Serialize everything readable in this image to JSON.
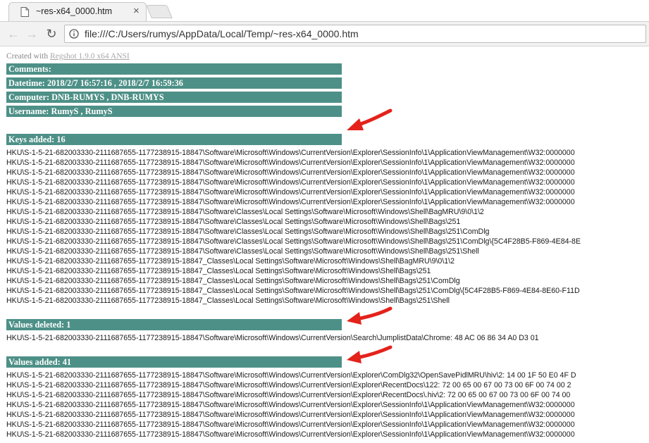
{
  "browser": {
    "tab_title": "~res-x64_0000.htm",
    "tab_close": "×",
    "url": "file:///C:/Users/rumys/AppData/Local/Temp/~res-x64_0000.htm",
    "icons": {
      "back": "←",
      "forward": "→",
      "reload": "↻"
    }
  },
  "page": {
    "created_prefix": "Created with ",
    "created_link": "Regshot 1.9.0 x64 ANSI",
    "headers": {
      "comments": "Comments:",
      "datetime": "Datetime: 2018/2/7 16:57:16 , 2018/2/7 16:59:36",
      "computer": "Computer: DNB-RUMYS , DNB-RUMYS",
      "username": "Username: RumyS , RumyS",
      "keys_added": "Keys added: 16",
      "values_deleted": "Values deleted: 1",
      "values_added": "Values added: 41"
    },
    "keys_added": [
      "HKU\\S-1-5-21-682003330-2111687655-1177238915-18847\\Software\\Microsoft\\Windows\\CurrentVersion\\Explorer\\SessionInfo\\1\\ApplicationViewManagement\\W32:0000000",
      "HKU\\S-1-5-21-682003330-2111687655-1177238915-18847\\Software\\Microsoft\\Windows\\CurrentVersion\\Explorer\\SessionInfo\\1\\ApplicationViewManagement\\W32:0000000",
      "HKU\\S-1-5-21-682003330-2111687655-1177238915-18847\\Software\\Microsoft\\Windows\\CurrentVersion\\Explorer\\SessionInfo\\1\\ApplicationViewManagement\\W32:0000000",
      "HKU\\S-1-5-21-682003330-2111687655-1177238915-18847\\Software\\Microsoft\\Windows\\CurrentVersion\\Explorer\\SessionInfo\\1\\ApplicationViewManagement\\W32:0000000",
      "HKU\\S-1-5-21-682003330-2111687655-1177238915-18847\\Software\\Microsoft\\Windows\\CurrentVersion\\Explorer\\SessionInfo\\1\\ApplicationViewManagement\\W32:0000000",
      "HKU\\S-1-5-21-682003330-2111687655-1177238915-18847\\Software\\Microsoft\\Windows\\CurrentVersion\\Explorer\\SessionInfo\\1\\ApplicationViewManagement\\W32:0000000",
      "HKU\\S-1-5-21-682003330-2111687655-1177238915-18847\\Software\\Classes\\Local Settings\\Software\\Microsoft\\Windows\\Shell\\BagMRU\\9\\0\\1\\2",
      "HKU\\S-1-5-21-682003330-2111687655-1177238915-18847\\Software\\Classes\\Local Settings\\Software\\Microsoft\\Windows\\Shell\\Bags\\251",
      "HKU\\S-1-5-21-682003330-2111687655-1177238915-18847\\Software\\Classes\\Local Settings\\Software\\Microsoft\\Windows\\Shell\\Bags\\251\\ComDlg",
      "HKU\\S-1-5-21-682003330-2111687655-1177238915-18847\\Software\\Classes\\Local Settings\\Software\\Microsoft\\Windows\\Shell\\Bags\\251\\ComDlg\\{5C4F28B5-F869-4E84-8E",
      "HKU\\S-1-5-21-682003330-2111687655-1177238915-18847\\Software\\Classes\\Local Settings\\Software\\Microsoft\\Windows\\Shell\\Bags\\251\\Shell",
      "HKU\\S-1-5-21-682003330-2111687655-1177238915-18847_Classes\\Local Settings\\Software\\Microsoft\\Windows\\Shell\\BagMRU\\9\\0\\1\\2",
      "HKU\\S-1-5-21-682003330-2111687655-1177238915-18847_Classes\\Local Settings\\Software\\Microsoft\\Windows\\Shell\\Bags\\251",
      "HKU\\S-1-5-21-682003330-2111687655-1177238915-18847_Classes\\Local Settings\\Software\\Microsoft\\Windows\\Shell\\Bags\\251\\ComDlg",
      "HKU\\S-1-5-21-682003330-2111687655-1177238915-18847_Classes\\Local Settings\\Software\\Microsoft\\Windows\\Shell\\Bags\\251\\ComDlg\\{5C4F28B5-F869-4E84-8E60-F11D",
      "HKU\\S-1-5-21-682003330-2111687655-1177238915-18847_Classes\\Local Settings\\Software\\Microsoft\\Windows\\Shell\\Bags\\251\\Shell"
    ],
    "values_deleted": [
      "HKU\\S-1-5-21-682003330-2111687655-1177238915-18847\\Software\\Microsoft\\Windows\\CurrentVersion\\Search\\JumplistData\\Chrome: 48 AC 06 86 34 A0 D3 01"
    ],
    "values_added": [
      "HKU\\S-1-5-21-682003330-2111687655-1177238915-18847\\Software\\Microsoft\\Windows\\CurrentVersion\\Explorer\\ComDlg32\\OpenSavePidlMRU\\hiv\\2: 14 00 1F 50 E0 4F D",
      "HKU\\S-1-5-21-682003330-2111687655-1177238915-18847\\Software\\Microsoft\\Windows\\CurrentVersion\\Explorer\\RecentDocs\\122: 72 00 65 00 67 00 73 00 6F 00 74 00 2",
      "HKU\\S-1-5-21-682003330-2111687655-1177238915-18847\\Software\\Microsoft\\Windows\\CurrentVersion\\Explorer\\RecentDocs\\.hiv\\2: 72 00 65 00 67 00 73 00 6F 00 74 00",
      "HKU\\S-1-5-21-682003330-2111687655-1177238915-18847\\Software\\Microsoft\\Windows\\CurrentVersion\\Explorer\\SessionInfo\\1\\ApplicationViewManagement\\W32:0000000",
      "HKU\\S-1-5-21-682003330-2111687655-1177238915-18847\\Software\\Microsoft\\Windows\\CurrentVersion\\Explorer\\SessionInfo\\1\\ApplicationViewManagement\\W32:0000000",
      "HKU\\S-1-5-21-682003330-2111687655-1177238915-18847\\Software\\Microsoft\\Windows\\CurrentVersion\\Explorer\\SessionInfo\\1\\ApplicationViewManagement\\W32:0000000",
      "HKU\\S-1-5-21-682003330-2111687655-1177238915-18847\\Software\\Microsoft\\Windows\\CurrentVersion\\Explorer\\SessionInfo\\1\\ApplicationViewManagement\\W32:0000000"
    ]
  },
  "colors": {
    "header_bg": "#4d9087",
    "arrow": "#e3231b"
  }
}
